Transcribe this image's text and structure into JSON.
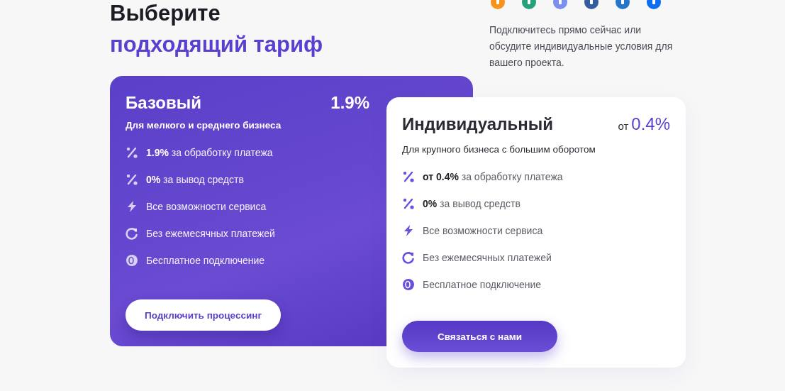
{
  "heading": {
    "line_1": "Выберите",
    "line_2": "подходящий тариф"
  },
  "coins": [
    {
      "color": "#f7931a"
    },
    {
      "color": "#26a17b"
    },
    {
      "color": "#7b8ff0"
    },
    {
      "color": "#345d9d"
    },
    {
      "color": "#2775ca"
    },
    {
      "color": "#0c6cf2"
    }
  ],
  "intro": "Подключитесь прямо сейчас или обсудите индивидуальные условия для вашего проекта.",
  "plans": [
    {
      "kind": "filled",
      "name": "Базовый",
      "price": "1.9%",
      "subtitle": "Для мелкого и среднего бизнеса",
      "features": [
        {
          "kind": "percent",
          "text": "**1.9%** за обработку платежа"
        },
        {
          "kind": "percent",
          "text": "**0%** за вывод средств"
        },
        {
          "kind": "bolt",
          "text": "Все возможности сервиса"
        },
        {
          "kind": "refresh",
          "text": "Без ежемесячных платежей"
        },
        {
          "kind": "coin",
          "text": "Бесплатное подключение"
        }
      ],
      "button": "Подключить процессинг"
    },
    {
      "kind": "white",
      "name": "Индивидуальный",
      "price_prefix": "от",
      "price": "0.4%",
      "subtitle": "Для крупного бизнеса с большим оборотом",
      "features": [
        {
          "kind": "percent",
          "text": "**от 0.4%** за обработку платежа"
        },
        {
          "kind": "percent",
          "text": "**0%** за вывод средств"
        },
        {
          "kind": "bolt",
          "text": "Все возможности сервиса"
        },
        {
          "kind": "refresh",
          "text": "Без ежемесячных платежей"
        },
        {
          "kind": "coin",
          "text": "Бесплатное подключение"
        }
      ],
      "button": "Связаться с нами"
    }
  ]
}
